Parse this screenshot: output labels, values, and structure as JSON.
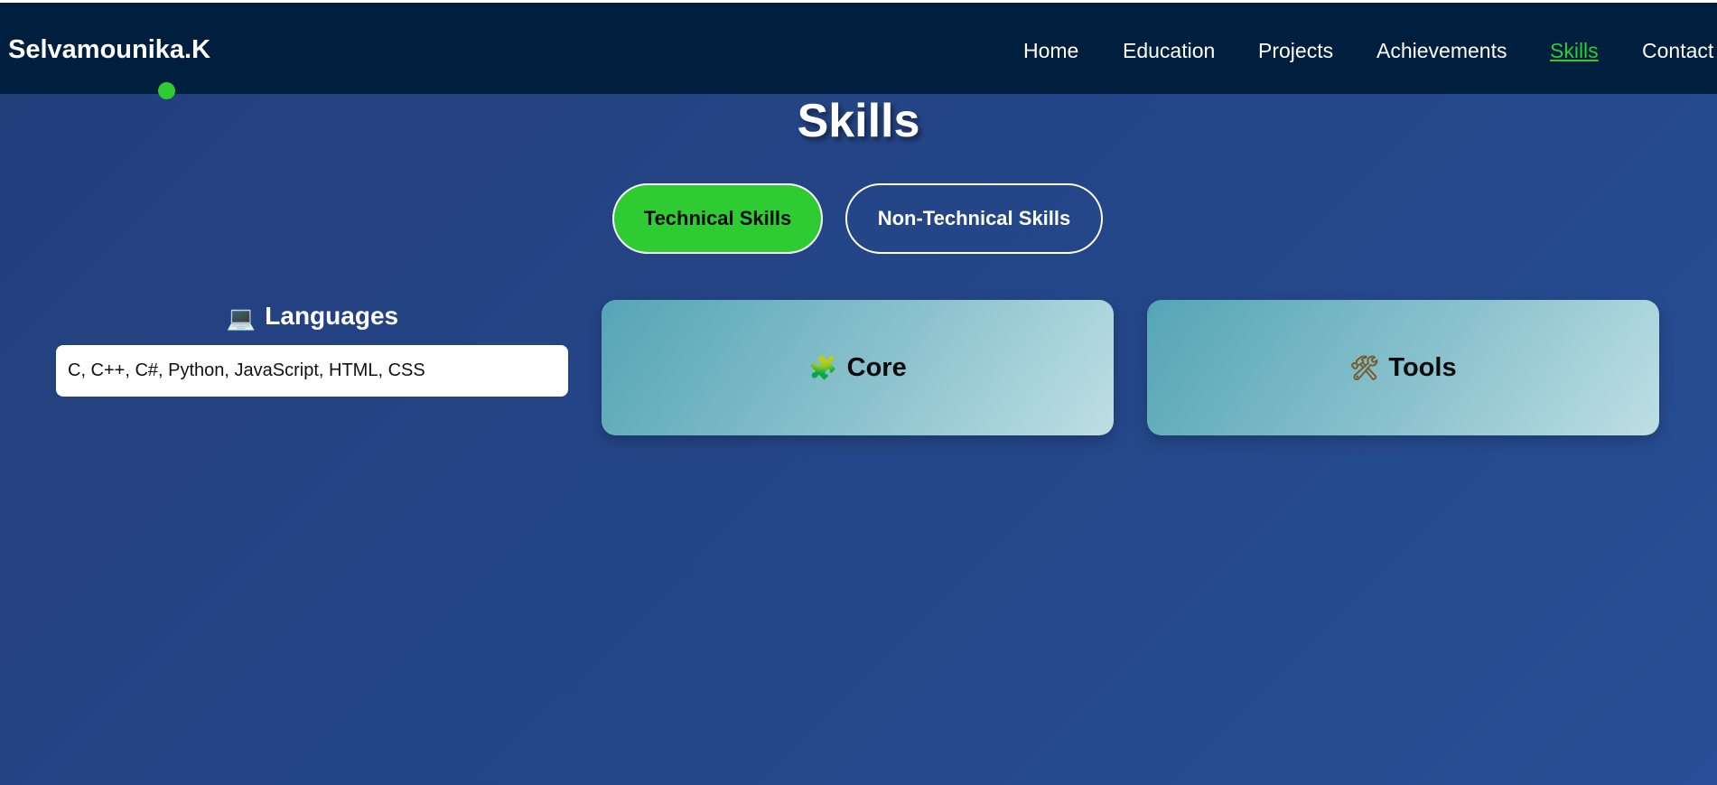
{
  "brand": {
    "name": "Selvamounika.K"
  },
  "nav": {
    "items": [
      {
        "label": "Home",
        "active": false
      },
      {
        "label": "Education",
        "active": false
      },
      {
        "label": "Projects",
        "active": false
      },
      {
        "label": "Achievements",
        "active": false
      },
      {
        "label": "Skills",
        "active": true
      },
      {
        "label": "Contact",
        "active": false
      }
    ]
  },
  "page": {
    "title": "Skills"
  },
  "tabs": {
    "technical": "Technical Skills",
    "non_technical": "Non-Technical Skills",
    "selected": "technical"
  },
  "languages": {
    "icon": "laptop-icon",
    "heading": "Languages",
    "value": "C, C++, C#, Python, JavaScript, HTML, CSS"
  },
  "cards": {
    "core": {
      "icon": "puzzle-icon",
      "label": "Core"
    },
    "tools": {
      "icon": "tools-icon",
      "label": "Tools"
    }
  },
  "colors": {
    "navbar_bg": "#001e3e",
    "page_bg": "#25478a",
    "accent_green": "#2ecc32",
    "card_gradient_start": "#55a5b6",
    "card_gradient_end": "#bedfe4"
  }
}
